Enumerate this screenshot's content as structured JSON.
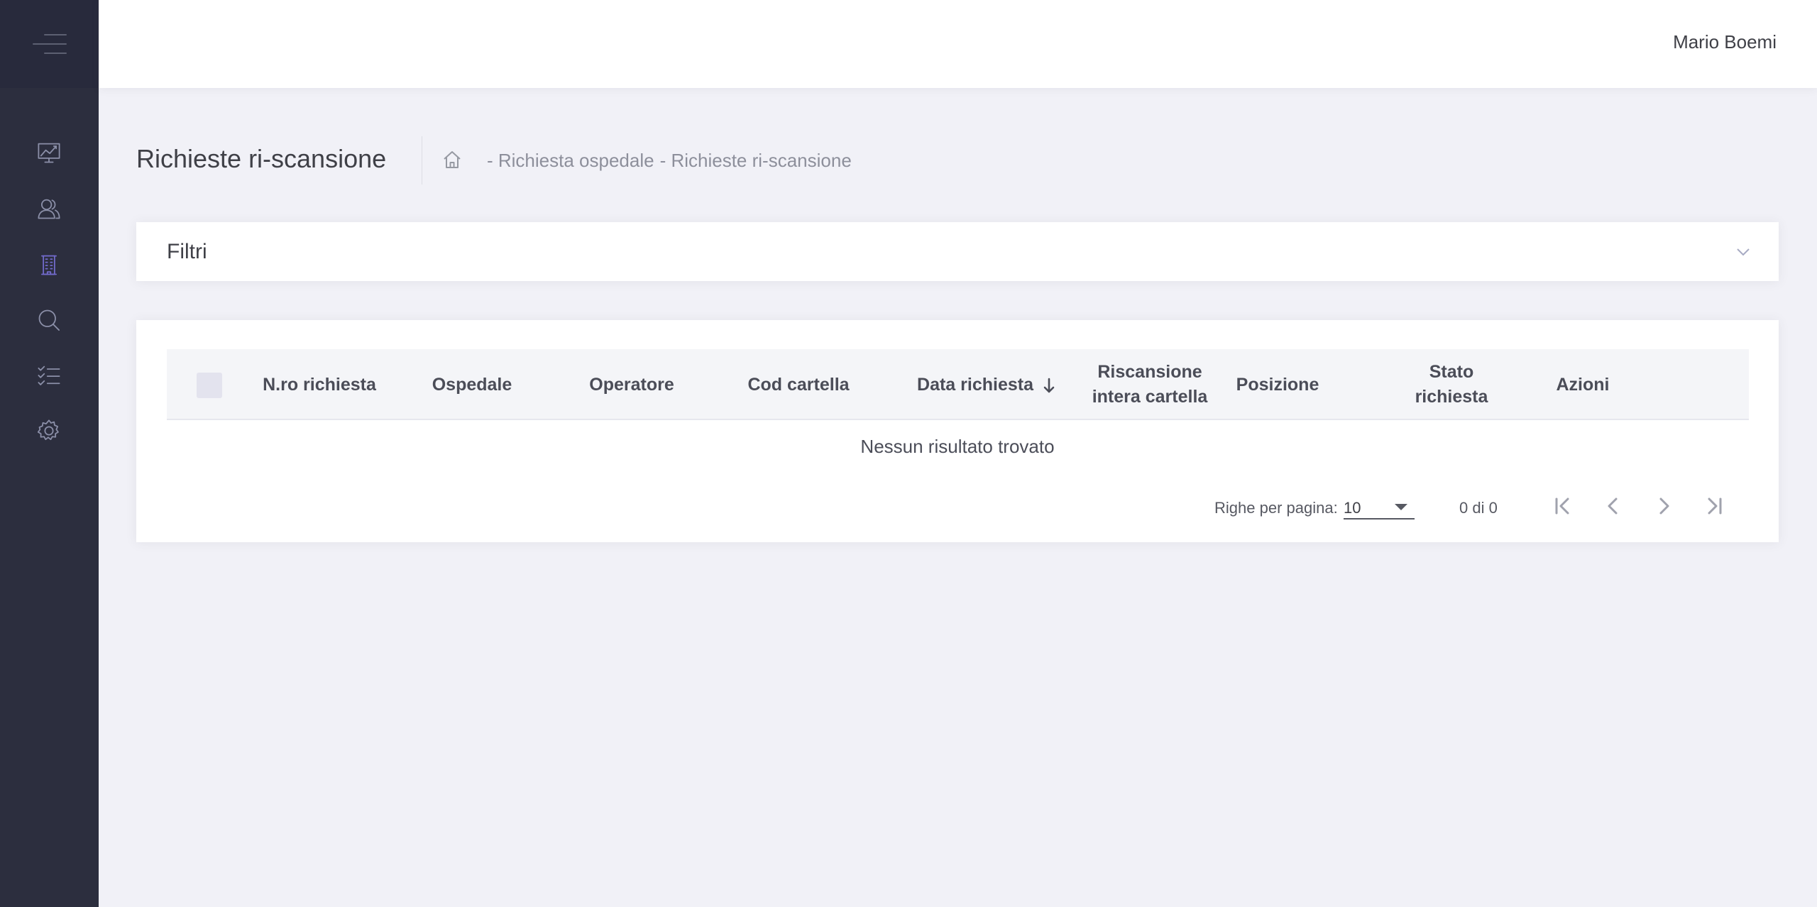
{
  "header": {
    "user_name": "Mario Boemi"
  },
  "sidebar": {
    "items": [
      {
        "icon": "chart-icon",
        "name": "sidebar-item-dashboard",
        "active": false
      },
      {
        "icon": "users-icon",
        "name": "sidebar-item-users",
        "active": false
      },
      {
        "icon": "building-icon",
        "name": "sidebar-item-hospital-requests",
        "active": true
      },
      {
        "icon": "search-icon",
        "name": "sidebar-item-search",
        "active": false
      },
      {
        "icon": "checklist-icon",
        "name": "sidebar-item-tasks",
        "active": false
      },
      {
        "icon": "gear-icon",
        "name": "sidebar-item-settings",
        "active": false
      }
    ]
  },
  "page": {
    "title": "Richieste ri-scansione",
    "breadcrumb": [
      "- Richiesta ospedale",
      "- Richieste ri-scansione"
    ]
  },
  "filters": {
    "title": "Filtri"
  },
  "table": {
    "columns": [
      "N.ro richiesta",
      "Ospedale",
      "Operatore",
      "Cod cartella",
      "Data richiesta",
      "Riscansione intera cartella",
      "Posizione",
      "Stato richiesta",
      "Azioni"
    ],
    "sorted_column": "Data richiesta",
    "sort_direction": "descending",
    "empty_message": "Nessun risultato trovato",
    "rows": []
  },
  "pagination": {
    "rows_per_page_label": "Righe per pagina:",
    "rows_per_page": "10",
    "range": "0 di 0"
  },
  "colors": {
    "sidebar": "#2c2e3e",
    "accent": "#716aca",
    "background": "#f1f1f7"
  }
}
